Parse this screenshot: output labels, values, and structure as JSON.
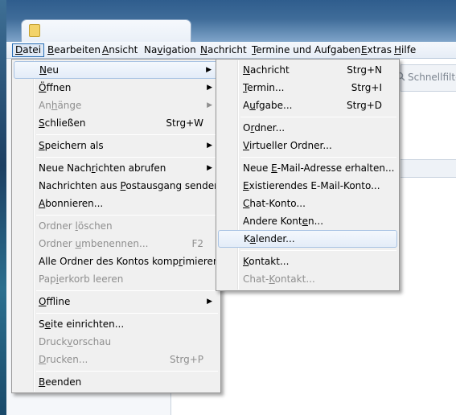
{
  "menubar": {
    "items": [
      {
        "label": "Datei",
        "access": 0
      },
      {
        "label": "Bearbeiten",
        "access": 0
      },
      {
        "label": "Ansicht",
        "access": 0
      },
      {
        "label": "Navigation",
        "access": 2
      },
      {
        "label": "Nachricht",
        "access": 0
      },
      {
        "label": "Termine und Aufgaben",
        "access": 0
      },
      {
        "label": "Extras",
        "access": 0
      },
      {
        "label": "Hilfe",
        "access": 0
      }
    ]
  },
  "quickfilter": {
    "label": "Schnellfilter"
  },
  "datei_menu": {
    "items": [
      {
        "label": "Neu",
        "access": 0,
        "submenu": true,
        "highlighted": true
      },
      {
        "label": "Öffnen",
        "access": 0,
        "submenu": true
      },
      {
        "label": "Anhänge",
        "access": 2,
        "submenu": true,
        "disabled": true
      },
      {
        "label": "Schließen",
        "access": 0,
        "shortcut": "Strg+W"
      },
      {
        "label": "Speichern als",
        "access": 0,
        "submenu": true
      },
      {
        "label": "Neue Nachrichten abrufen",
        "access": 9,
        "submenu": true
      },
      {
        "label": "Nachrichten aus Postausgang senden",
        "access": 16
      },
      {
        "label": "Abonnieren...",
        "access": 0
      },
      {
        "label": "Ordner löschen",
        "access": 7,
        "disabled": true
      },
      {
        "label": "Ordner umbenennen...",
        "access": 7,
        "disabled": true,
        "shortcut": "F2"
      },
      {
        "label": "Alle Ordner des Kontos komprimieren",
        "access": 27
      },
      {
        "label": "Papierkorb leeren",
        "access": 3,
        "disabled": true
      },
      {
        "label": "Offline",
        "access": 0,
        "submenu": true
      },
      {
        "label": "Seite einrichten...",
        "access": 1
      },
      {
        "label": "Druckvorschau",
        "access": 5,
        "disabled": true
      },
      {
        "label": "Drucken...",
        "access": 0,
        "disabled": true,
        "shortcut": "Strg+P"
      },
      {
        "label": "Beenden",
        "access": 0
      }
    ]
  },
  "neu_menu": {
    "items": [
      {
        "label": "Nachricht",
        "access": 0,
        "shortcut": "Strg+N"
      },
      {
        "label": "Termin...",
        "access": 0,
        "shortcut": "Strg+I"
      },
      {
        "label": "Aufgabe...",
        "access": 1,
        "shortcut": "Strg+D"
      },
      {
        "label": "Ordner...",
        "access": 1
      },
      {
        "label": "Virtueller Ordner...",
        "access": 0
      },
      {
        "label": "Neue E-Mail-Adresse erhalten...",
        "access": 5
      },
      {
        "label": "Existierendes E-Mail-Konto...",
        "access": 0
      },
      {
        "label": "Chat-Konto...",
        "access": 0
      },
      {
        "label": "Andere Konten...",
        "access": 11
      },
      {
        "label": "Kalender...",
        "access": 1,
        "highlighted": true
      },
      {
        "label": "Kontakt...",
        "access": 0
      },
      {
        "label": "Chat-Kontakt...",
        "access": 5,
        "disabled": true
      }
    ]
  }
}
